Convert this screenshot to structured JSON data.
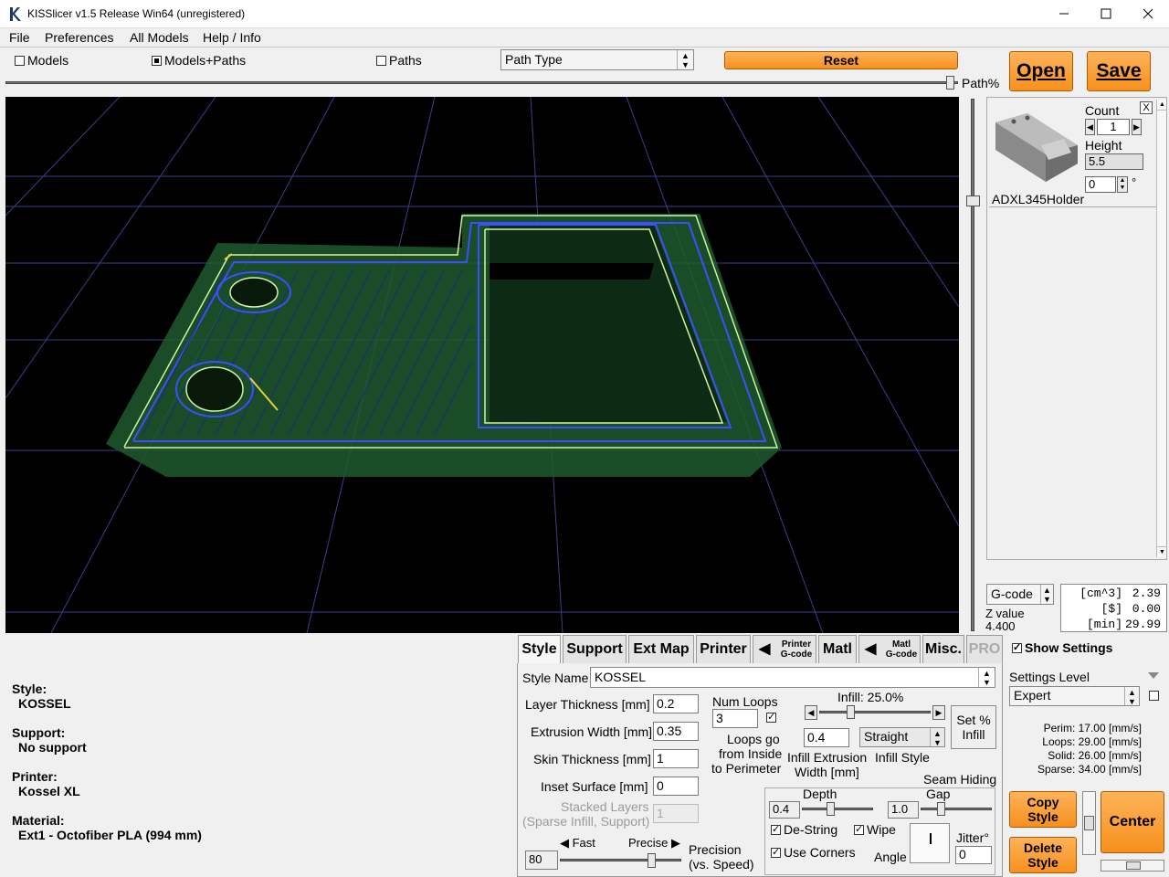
{
  "window": {
    "title": "KISSlicer v1.5 Release Win64 (unregistered)"
  },
  "menu": [
    "File",
    "Preferences",
    "All Models",
    "Help / Info"
  ],
  "view_toggles": {
    "models": "Models",
    "models_paths": "Models+Paths",
    "paths": "Paths"
  },
  "path_type": "Path Type",
  "reset_label": "Reset",
  "path_pct_label": "Path%",
  "open_label": "Open",
  "save_label": "Save",
  "model_panel": {
    "count_label": "Count",
    "count_value": "1",
    "height_label": "Height",
    "height_value": "5.5",
    "rot_value": "0",
    "deg": "°",
    "close": "X",
    "name": "ADXL345Holder"
  },
  "stats": {
    "mode": "G-code",
    "zvalue_label": "Z value",
    "zvalue": "4.400",
    "vol_label": "[cm^3]",
    "vol": "2.39",
    "cost_label": "[$]",
    "cost": "0.00",
    "time_label": "[min]",
    "time": "29.99"
  },
  "summary": {
    "style_label": "Style:",
    "style": "KOSSEL",
    "support_label": "Support:",
    "support": "No support",
    "printer_label": "Printer:",
    "printer": "Kossel XL",
    "material_label": "Material:",
    "material": "Ext1 - Octofiber PLA (994 mm)"
  },
  "tabs": {
    "style": "Style",
    "support": "Support",
    "extmap": "Ext Map",
    "printer": "Printer",
    "printer_gcode_1": "Printer",
    "printer_gcode_2": "G-code",
    "matl": "Matl",
    "matl_gcode_1": "Matl",
    "matl_gcode_2": "G-code",
    "misc": "Misc.",
    "pro": "PRO"
  },
  "style_tab": {
    "style_name_label": "Style Name",
    "style_name": "KOSSEL",
    "layer_label": "Layer Thickness [mm]",
    "layer": "0.2",
    "extrusion_label": "Extrusion Width [mm]",
    "extrusion": "0.35",
    "skin_label": "Skin Thickness [mm]",
    "skin": "1",
    "inset_label": "Inset  Surface [mm]",
    "inset": "0",
    "stacked_1": "Stacked Layers",
    "stacked_2": "(Sparse Infill, Support)",
    "stacked": "1",
    "fast": "Fast",
    "precise": "Precise",
    "precision_value": "80",
    "precision_1": "Precision",
    "precision_2": "(vs. Speed)",
    "num_loops_label": "Num Loops",
    "num_loops": "3",
    "loops_1": "Loops go",
    "loops_2": "from Inside",
    "loops_3": "to Perimeter",
    "infill_label": "Infill: 25.0%",
    "infill_width": "0.4",
    "infill_width_1": "Infill Extrusion",
    "infill_width_2": "Width [mm]",
    "infill_style": "Straight",
    "infill_style_label": "Infill Style",
    "set_infill_1": "Set %",
    "set_infill_2": "Infill",
    "seam_label": "Seam Hiding",
    "depth_label": "Depth",
    "depth": "0.4",
    "gap_label": "Gap",
    "gap": "1.0",
    "destring": "De-String",
    "wipe": "Wipe",
    "use_corners": "Use Corners",
    "angle": "Angle",
    "jitter_label": "Jitter°",
    "jitter": "0"
  },
  "settings": {
    "show_settings": "Show Settings",
    "level_label": "Settings Level",
    "level": "Expert",
    "perim": "Perim:  17.00 [mm/s]",
    "loops": "Loops:  29.00 [mm/s]",
    "solid": "Solid:  26.00 [mm/s]",
    "sparse": "Sparse: 34.00 [mm/s]"
  },
  "buttons": {
    "copy_1": "Copy",
    "copy_2": "Style",
    "delete_1": "Delete",
    "delete_2": "Style",
    "center": "Center"
  }
}
